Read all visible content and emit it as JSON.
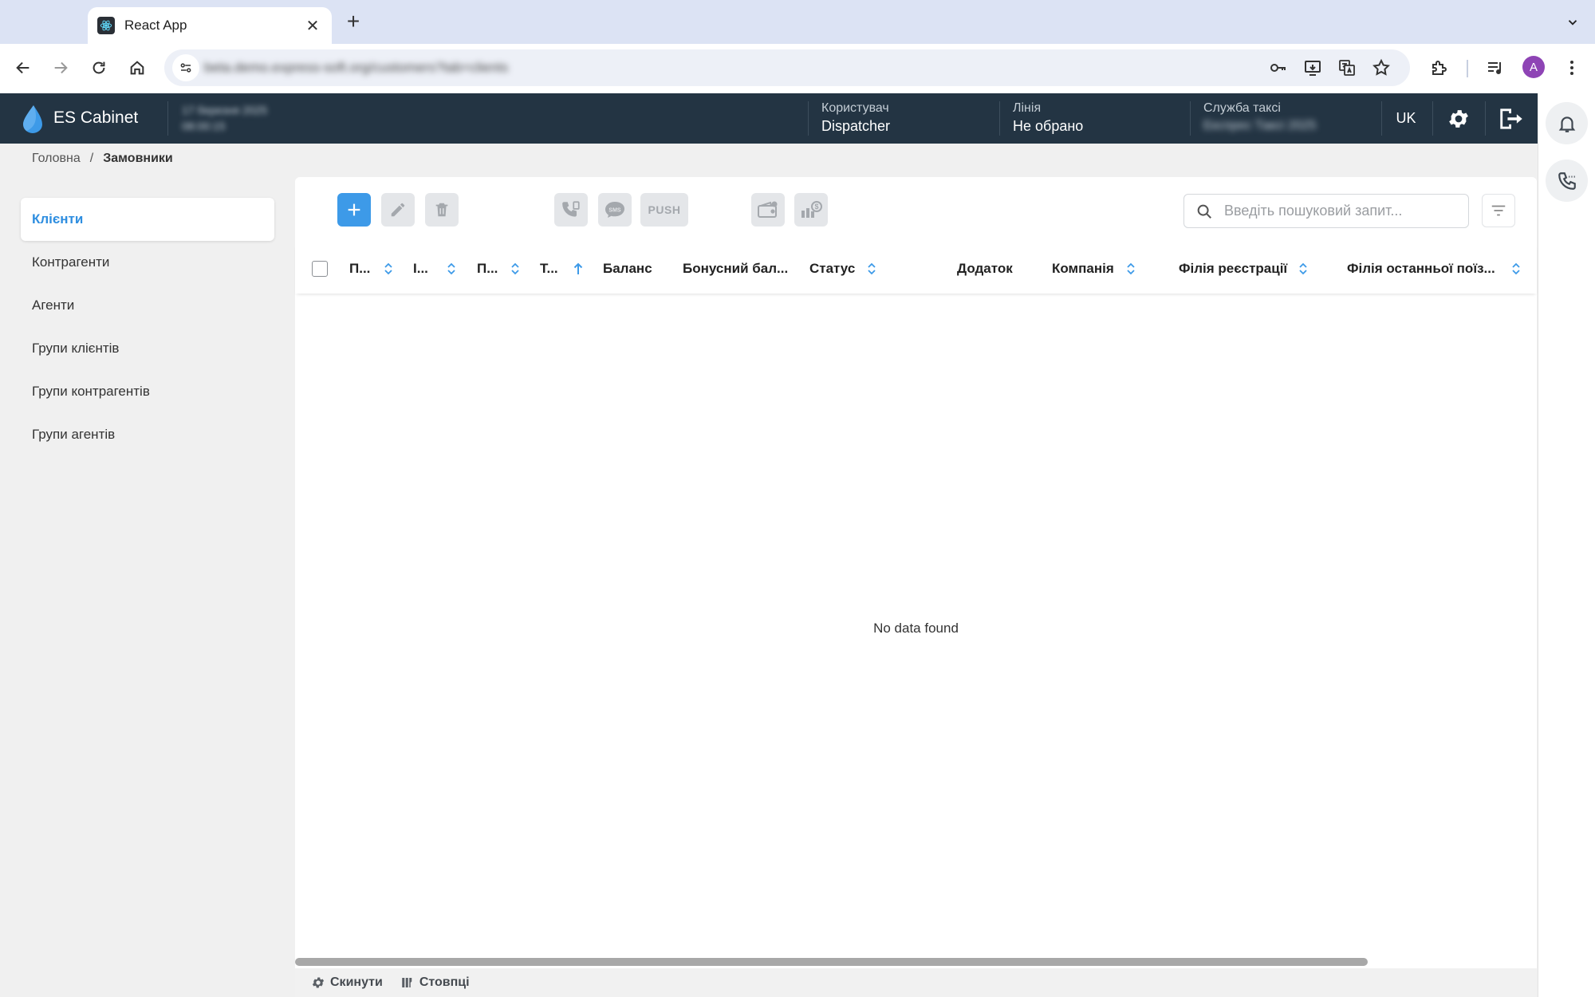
{
  "browser": {
    "tab_title": "React App",
    "tab_close": "✕",
    "new_tab": "+",
    "url": "beta.demo.express-soft.org/customers?tab=clients",
    "avatar_letter": "A"
  },
  "header": {
    "brand": "ES Cabinet",
    "date": "17 березня 2025",
    "time": "08:00:15",
    "user_label": "Користувач",
    "user_value": "Dispatcher",
    "line_label": "Лінія",
    "line_value": "Не обрано",
    "service_label": "Служба таксі",
    "service_value": "Експрес Таксі 2025",
    "lang": "UK"
  },
  "breadcrumb": {
    "home": "Головна",
    "separator": "/",
    "current": "Замовники"
  },
  "sidebar": {
    "items": [
      {
        "label": "Клієнти"
      },
      {
        "label": "Контрагенти"
      },
      {
        "label": "Агенти"
      },
      {
        "label": "Групи клієнтів"
      },
      {
        "label": "Групи контрагентів"
      },
      {
        "label": "Групи агентів"
      }
    ]
  },
  "actions": {
    "push_label": "PUSH"
  },
  "search": {
    "placeholder": "Введіть пошуковий запит..."
  },
  "table": {
    "columns": [
      {
        "label": "П..."
      },
      {
        "label": "І..."
      },
      {
        "label": "П..."
      },
      {
        "label": "Т..."
      },
      {
        "label": "Баланс"
      },
      {
        "label": "Бонусний бал..."
      },
      {
        "label": "Статус"
      },
      {
        "label": "Додаток"
      },
      {
        "label": "Компанія"
      },
      {
        "label": "Філія реєстрації"
      },
      {
        "label": "Філія останньої поїз..."
      }
    ],
    "empty_text": "No data found"
  },
  "footer": {
    "reset_label": "Скинути",
    "columns_label": "Стовпці"
  },
  "colors": {
    "header_bg": "#233443",
    "accent": "#3d9ae8",
    "active_link": "#2e8ee0"
  }
}
